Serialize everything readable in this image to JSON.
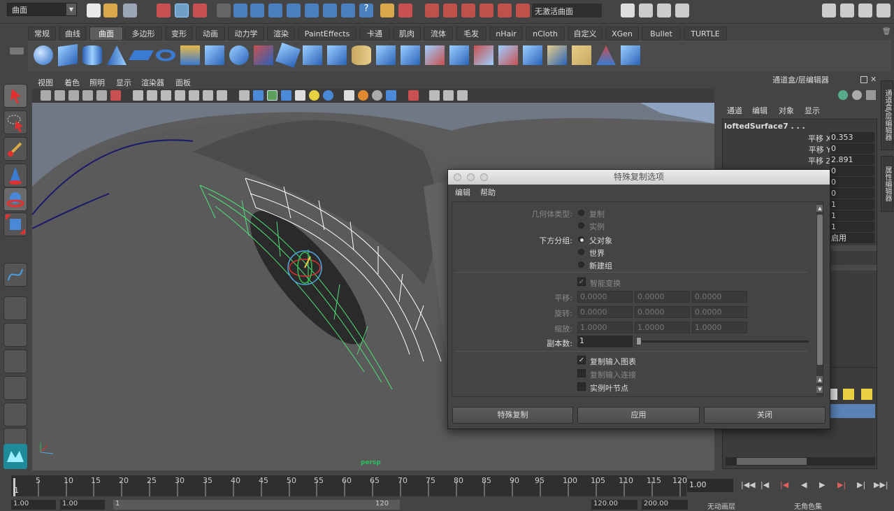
{
  "statusline": {
    "mode_menu": "曲面",
    "no_live": "无激活曲面"
  },
  "shelf_tabs": [
    "常规",
    "曲线",
    "曲面",
    "多边形",
    "变形",
    "动画",
    "动力学",
    "渲染",
    "PaintEffects",
    "卡通",
    "肌肉",
    "流体",
    "毛发",
    "nHair",
    "nCloth",
    "自定义",
    "XGen",
    "Bullet",
    "TURTLE"
  ],
  "active_shelf_tab": "曲面",
  "viewport": {
    "menu": [
      "视图",
      "着色",
      "照明",
      "显示",
      "渲染器",
      "面板"
    ],
    "camera_label": "persp"
  },
  "channel_box": {
    "title": "通道盒/层编辑器",
    "menu": [
      "通道",
      "编辑",
      "对象",
      "显示"
    ],
    "object_name": "loftedSurface7 . . .",
    "channels": [
      {
        "label": "平移 X",
        "value": "0.353"
      },
      {
        "label": "平移 Y",
        "value": "0"
      },
      {
        "label": "平移 Z",
        "value": "2.891"
      },
      {
        "label": "",
        "value": "0"
      },
      {
        "label": "",
        "value": "0"
      },
      {
        "label": "",
        "value": "0"
      },
      {
        "label": "",
        "value": "1"
      },
      {
        "label": "",
        "value": "1"
      },
      {
        "label": "",
        "value": "1"
      },
      {
        "label": "",
        "value": "启用"
      }
    ],
    "side_tabs": [
      "通道盒/层编辑器",
      "属性编辑器"
    ]
  },
  "dialog": {
    "title": "特殊复制选项",
    "menu": [
      "编辑",
      "帮助"
    ],
    "geometry_type_label": "几何体类型:",
    "geometry_options": [
      "复制",
      "实例"
    ],
    "group_under_label": "下方分组:",
    "group_options": [
      "父对象",
      "世界",
      "新建组"
    ],
    "smart_transform": "智能变换",
    "translate_label": "平移:",
    "rotate_label": "旋转:",
    "scale_label": "缩放:",
    "translate": [
      "0.0000",
      "0.0000",
      "0.0000"
    ],
    "rotate": [
      "0.0000",
      "0.0000",
      "0.0000"
    ],
    "scale": [
      "1.0000",
      "1.0000",
      "1.0000"
    ],
    "copies_label": "副本数:",
    "copies": "1",
    "dup_input_graph": "复制输入图表",
    "dup_input_connections": "复制输入连接",
    "instance_leaf": "实例叶节点",
    "buttons": {
      "special": "特殊复制",
      "apply": "应用",
      "close": "关闭"
    }
  },
  "timeline": {
    "ticks": [
      "5",
      "10",
      "15",
      "20",
      "25",
      "30",
      "35",
      "40",
      "45",
      "50",
      "55",
      "60",
      "65",
      "70",
      "75",
      "80",
      "85",
      "90",
      "95",
      "100",
      "105",
      "110",
      "115",
      "120"
    ],
    "start_frame": "1",
    "current_time": "1.00"
  },
  "range": {
    "start": "1.00",
    "start2": "1.00",
    "slider_start": "1",
    "slider_end": "120",
    "end": "120.00",
    "end2": "200.00",
    "layer": "无动画层",
    "char": "无角色集"
  }
}
